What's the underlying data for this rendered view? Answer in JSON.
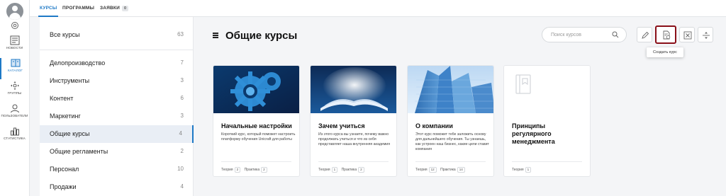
{
  "nav": {
    "items": [
      {
        "label": "НОВОСТИ",
        "icon": "news-icon"
      },
      {
        "label": "КАТАЛОГ",
        "icon": "catalog-icon"
      },
      {
        "label": "ГРУППЫ",
        "icon": "groups-icon"
      },
      {
        "label": "ПОЛЬЗОВАТЕЛИ",
        "icon": "users-icon"
      },
      {
        "label": "СТАТИСТИКА",
        "icon": "statistics-icon"
      }
    ],
    "active": "КАТАЛОГ",
    "accent": "#1e79c6"
  },
  "tabs": [
    {
      "label": "КУРСЫ"
    },
    {
      "label": "ПРОГРАММЫ"
    },
    {
      "label": "ЗАЯВКИ",
      "badge": "0"
    }
  ],
  "categories": [
    {
      "name": "Все курсы",
      "count": "63"
    },
    {
      "name": "Делопроизводство",
      "count": "7"
    },
    {
      "name": "Инструменты",
      "count": "3"
    },
    {
      "name": "Контент",
      "count": "6"
    },
    {
      "name": "Маркетинг",
      "count": "3"
    },
    {
      "name": "Общие курсы",
      "count": "4"
    },
    {
      "name": "Общие регламенты",
      "count": "2"
    },
    {
      "name": "Персонал",
      "count": "10"
    },
    {
      "name": "Продажи",
      "count": "4"
    }
  ],
  "selected_category": "Общие курсы",
  "header": {
    "title": "Общие курсы",
    "search_placeholder": "Поиск курсов",
    "tooltip": "Создать курс",
    "highlight_color": "#8a1019"
  },
  "cards": [
    {
      "title": "Начальные настройки",
      "description": "Короткий курс, который поможет настроить платформу обучения Unicraft для работы",
      "theory_label": "Теория",
      "theory": "2",
      "practice_label": "Практика",
      "practice": "2",
      "image": "gears"
    },
    {
      "title": "Зачем учиться",
      "description": "Из этого курса вы узнаете, почему важно продолжать учиться и что из себя представляет наша внутренняя академия",
      "theory_label": "Теория",
      "theory": "1",
      "practice_label": "Практика",
      "practice": "2",
      "image": "book"
    },
    {
      "title": "О компании",
      "description": "Этот курс поможет тебе заложить основу для дальнейшего обучения. Ты узнаешь, как устроен наш бизнес, какие цели ставит компания",
      "theory_label": "Теория",
      "theory": "12",
      "practice_label": "Практика",
      "practice": "14",
      "image": "skyscrapers"
    },
    {
      "title": "Принципы регулярного менеджмента",
      "description": "",
      "theory_label": "Теория",
      "theory": "1",
      "image": "placeholder"
    }
  ]
}
